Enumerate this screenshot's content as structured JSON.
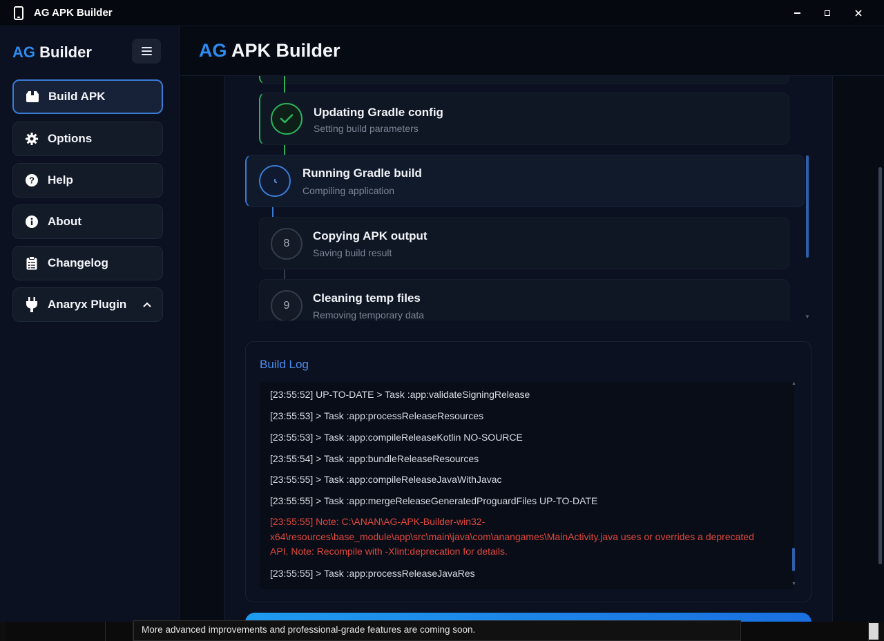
{
  "window": {
    "title": "AG APK Builder"
  },
  "sidebar": {
    "brand_ag": "AG",
    "brand_rest": "Builder",
    "items": [
      {
        "label": "Build APK",
        "icon": "box-icon",
        "active": true
      },
      {
        "label": "Options",
        "icon": "gear-icon"
      },
      {
        "label": "Help",
        "icon": "question-circle-icon"
      },
      {
        "label": "About",
        "icon": "info-circle-icon"
      },
      {
        "label": "Changelog",
        "icon": "clipboard-list-icon"
      },
      {
        "label": "Anaryx Plugin",
        "icon": "plug-icon",
        "expand": "chevron-up-icon"
      }
    ]
  },
  "header": {
    "title_ag": "AG",
    "title_rest": "APK Builder"
  },
  "steps": [
    {
      "status": "done",
      "title": "Updating Gradle config",
      "subtitle": "Setting build parameters"
    },
    {
      "status": "running",
      "title": "Running Gradle build",
      "subtitle": "Compiling application"
    },
    {
      "status": "pending",
      "number": "8",
      "title": "Copying APK output",
      "subtitle": "Saving build result"
    },
    {
      "status": "pending",
      "number": "9",
      "title": "Cleaning temp files",
      "subtitle": "Removing temporary data"
    }
  ],
  "build_log": {
    "title": "Build Log",
    "lines": [
      "[23:55:52] UP-TO-DATE > Task :app:validateSigningRelease",
      "[23:55:53] > Task :app:processReleaseResources",
      "[23:55:53] > Task :app:compileReleaseKotlin NO-SOURCE",
      "[23:55:54] > Task :app:bundleReleaseResources",
      "[23:55:55] > Task :app:compileReleaseJavaWithJavac",
      "[23:55:55] > Task :app:mergeReleaseGeneratedProguardFiles UP-TO-DATE"
    ],
    "error": "[23:55:55] Note: C:\\ANAN\\AG-APK-Builder-win32-x64\\resources\\base_module\\app\\src\\main\\java\\com\\anangames\\MainActivity.java uses or overrides a deprecated API. Note: Recompile with -Xlint:deprecation for details.",
    "last_line": "[23:55:55] > Task :app:processReleaseJavaRes"
  },
  "tooltip": {
    "text": "More advanced improvements and professional-grade features are coming soon."
  },
  "colors": {
    "accent": "#2d8cf0",
    "success": "#2bb35a",
    "running": "#3a7bd5",
    "error": "#e0483e"
  }
}
